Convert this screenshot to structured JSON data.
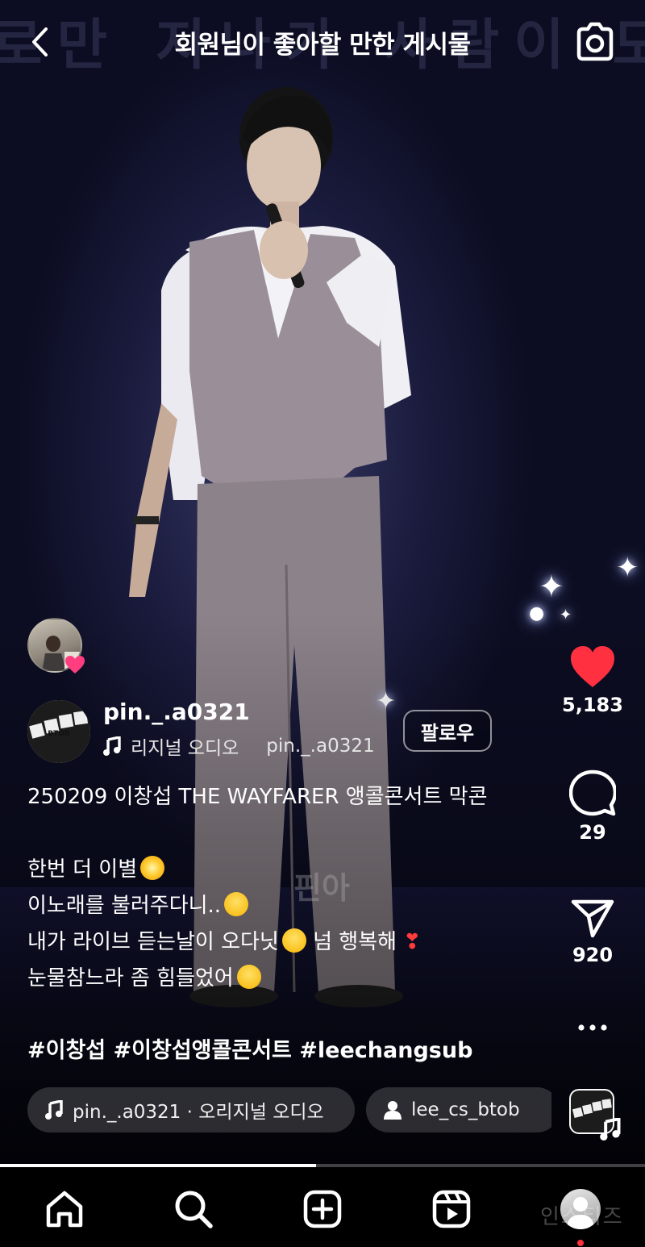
{
  "header": {
    "title": "회원님이 좋아할 만한 게시물",
    "background_text": "로만 지나가 사람이 도만",
    "back_icon": "chevron-left-icon",
    "camera_icon": "camera-icon"
  },
  "video": {
    "watermark": "핀아",
    "progress_fraction": 0.49
  },
  "actions": {
    "likes": "5,183",
    "comments": "29",
    "shares": "920",
    "like_color": "#ff3040",
    "more_icon": "more-horizontal-icon"
  },
  "post": {
    "author": "pin._.a0321",
    "audio_label": "리지널 오디오",
    "audio_author": "pin._.a0321",
    "follow_label": "팔로우",
    "caption_title": "250209 이창섭 THE WAYFARER 앵콜콘서트 막콘",
    "caption_lines": [
      "한번 더 이별",
      "이노래를 불러주다니..",
      "내가 라이브 듣는날이 오다닛",
      "넘 행복해",
      "눈물참느라 좀 힘들었어"
    ],
    "hashtags": "#이창섭 #이창섭앵콜콘서트 #leechangsub",
    "avatar_text": "BTOB"
  },
  "chips": {
    "audio": "pin._.a0321 · 오리지널 오디오",
    "tagged_user": "lee_cs_btob"
  },
  "nav": {
    "items": [
      "home-icon",
      "search-icon",
      "create-icon",
      "reels-icon",
      "profile-icon"
    ],
    "watermark": "인스티즈"
  }
}
